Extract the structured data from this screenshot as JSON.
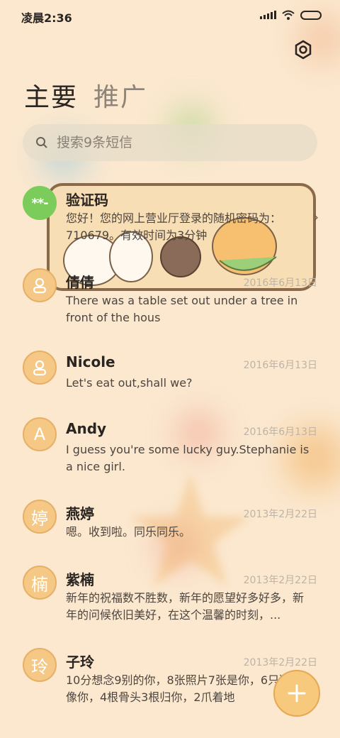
{
  "status_bar": {
    "time": "凌晨2:36"
  },
  "icons": {
    "settings": "gear-icon",
    "search": "search-icon",
    "fab": "plus-icon",
    "wifi": "wifi-icon",
    "signal": "signal-icon",
    "battery": "battery-icon",
    "chevron": "chevron-right-icon",
    "person": "person-icon"
  },
  "tabs": [
    {
      "label": "主要",
      "active": true
    },
    {
      "label": "推广",
      "active": false
    }
  ],
  "search": {
    "placeholder": "搜索9条短信"
  },
  "colors": {
    "background": "#fbe8cf",
    "avatar": "#f5c985",
    "verify_avatar": "#7ccc5c",
    "fab": "#f7c97c"
  },
  "messages": [
    {
      "avatar_text": "**-",
      "name": "验证码",
      "date": "",
      "preview": "您好！您的网上营业厅登录的随机密码为：710679。有效时间为3分钟"
    },
    {
      "avatar_text": "",
      "name": "倩倩",
      "date": "2016年6月13日",
      "preview": "There was a table set out under a tree in front of the hous"
    },
    {
      "avatar_text": "",
      "name": "Nicole",
      "date": "2016年6月13日",
      "preview": "Let's eat out,shall we?"
    },
    {
      "avatar_text": "A",
      "name": "Andy",
      "date": "2016年6月13日",
      "preview": "I guess you're some lucky guy.Stephanie is a nice girl."
    },
    {
      "avatar_text": "婷",
      "name": "燕婷",
      "date": "2013年2月22日",
      "preview": "嗯。收到啦。同乐同乐。"
    },
    {
      "avatar_text": "楠",
      "name": "紫楠",
      "date": "2013年2月22日",
      "preview": "新年的祝福数不胜数，新年的愿望好多好多，新年的问候依旧美好，在这个温馨的时刻，..."
    },
    {
      "avatar_text": "玲",
      "name": "子玲",
      "date": "2013年2月22日",
      "preview": "10分想念9别的你，8张照片7张是你，6只狗5只像你，4根骨头3根归你，2爪着地"
    }
  ]
}
